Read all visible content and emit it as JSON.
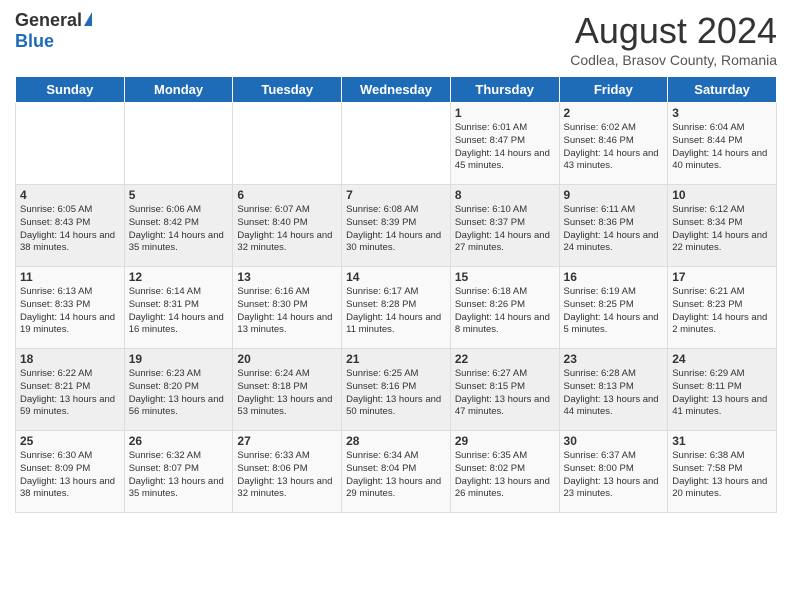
{
  "header": {
    "logo_general": "General",
    "logo_blue": "Blue",
    "month_year": "August 2024",
    "location": "Codlea, Brasov County, Romania"
  },
  "days_of_week": [
    "Sunday",
    "Monday",
    "Tuesday",
    "Wednesday",
    "Thursday",
    "Friday",
    "Saturday"
  ],
  "weeks": [
    [
      {
        "day": "",
        "info": ""
      },
      {
        "day": "",
        "info": ""
      },
      {
        "day": "",
        "info": ""
      },
      {
        "day": "",
        "info": ""
      },
      {
        "day": "1",
        "info": "Sunrise: 6:01 AM\nSunset: 8:47 PM\nDaylight: 14 hours\nand 45 minutes."
      },
      {
        "day": "2",
        "info": "Sunrise: 6:02 AM\nSunset: 8:46 PM\nDaylight: 14 hours\nand 43 minutes."
      },
      {
        "day": "3",
        "info": "Sunrise: 6:04 AM\nSunset: 8:44 PM\nDaylight: 14 hours\nand 40 minutes."
      }
    ],
    [
      {
        "day": "4",
        "info": "Sunrise: 6:05 AM\nSunset: 8:43 PM\nDaylight: 14 hours\nand 38 minutes."
      },
      {
        "day": "5",
        "info": "Sunrise: 6:06 AM\nSunset: 8:42 PM\nDaylight: 14 hours\nand 35 minutes."
      },
      {
        "day": "6",
        "info": "Sunrise: 6:07 AM\nSunset: 8:40 PM\nDaylight: 14 hours\nand 32 minutes."
      },
      {
        "day": "7",
        "info": "Sunrise: 6:08 AM\nSunset: 8:39 PM\nDaylight: 14 hours\nand 30 minutes."
      },
      {
        "day": "8",
        "info": "Sunrise: 6:10 AM\nSunset: 8:37 PM\nDaylight: 14 hours\nand 27 minutes."
      },
      {
        "day": "9",
        "info": "Sunrise: 6:11 AM\nSunset: 8:36 PM\nDaylight: 14 hours\nand 24 minutes."
      },
      {
        "day": "10",
        "info": "Sunrise: 6:12 AM\nSunset: 8:34 PM\nDaylight: 14 hours\nand 22 minutes."
      }
    ],
    [
      {
        "day": "11",
        "info": "Sunrise: 6:13 AM\nSunset: 8:33 PM\nDaylight: 14 hours\nand 19 minutes."
      },
      {
        "day": "12",
        "info": "Sunrise: 6:14 AM\nSunset: 8:31 PM\nDaylight: 14 hours\nand 16 minutes."
      },
      {
        "day": "13",
        "info": "Sunrise: 6:16 AM\nSunset: 8:30 PM\nDaylight: 14 hours\nand 13 minutes."
      },
      {
        "day": "14",
        "info": "Sunrise: 6:17 AM\nSunset: 8:28 PM\nDaylight: 14 hours\nand 11 minutes."
      },
      {
        "day": "15",
        "info": "Sunrise: 6:18 AM\nSunset: 8:26 PM\nDaylight: 14 hours\nand 8 minutes."
      },
      {
        "day": "16",
        "info": "Sunrise: 6:19 AM\nSunset: 8:25 PM\nDaylight: 14 hours\nand 5 minutes."
      },
      {
        "day": "17",
        "info": "Sunrise: 6:21 AM\nSunset: 8:23 PM\nDaylight: 14 hours\nand 2 minutes."
      }
    ],
    [
      {
        "day": "18",
        "info": "Sunrise: 6:22 AM\nSunset: 8:21 PM\nDaylight: 13 hours\nand 59 minutes."
      },
      {
        "day": "19",
        "info": "Sunrise: 6:23 AM\nSunset: 8:20 PM\nDaylight: 13 hours\nand 56 minutes."
      },
      {
        "day": "20",
        "info": "Sunrise: 6:24 AM\nSunset: 8:18 PM\nDaylight: 13 hours\nand 53 minutes."
      },
      {
        "day": "21",
        "info": "Sunrise: 6:25 AM\nSunset: 8:16 PM\nDaylight: 13 hours\nand 50 minutes."
      },
      {
        "day": "22",
        "info": "Sunrise: 6:27 AM\nSunset: 8:15 PM\nDaylight: 13 hours\nand 47 minutes."
      },
      {
        "day": "23",
        "info": "Sunrise: 6:28 AM\nSunset: 8:13 PM\nDaylight: 13 hours\nand 44 minutes."
      },
      {
        "day": "24",
        "info": "Sunrise: 6:29 AM\nSunset: 8:11 PM\nDaylight: 13 hours\nand 41 minutes."
      }
    ],
    [
      {
        "day": "25",
        "info": "Sunrise: 6:30 AM\nSunset: 8:09 PM\nDaylight: 13 hours\nand 38 minutes."
      },
      {
        "day": "26",
        "info": "Sunrise: 6:32 AM\nSunset: 8:07 PM\nDaylight: 13 hours\nand 35 minutes."
      },
      {
        "day": "27",
        "info": "Sunrise: 6:33 AM\nSunset: 8:06 PM\nDaylight: 13 hours\nand 32 minutes."
      },
      {
        "day": "28",
        "info": "Sunrise: 6:34 AM\nSunset: 8:04 PM\nDaylight: 13 hours\nand 29 minutes."
      },
      {
        "day": "29",
        "info": "Sunrise: 6:35 AM\nSunset: 8:02 PM\nDaylight: 13 hours\nand 26 minutes."
      },
      {
        "day": "30",
        "info": "Sunrise: 6:37 AM\nSunset: 8:00 PM\nDaylight: 13 hours\nand 23 minutes."
      },
      {
        "day": "31",
        "info": "Sunrise: 6:38 AM\nSunset: 7:58 PM\nDaylight: 13 hours\nand 20 minutes."
      }
    ]
  ]
}
